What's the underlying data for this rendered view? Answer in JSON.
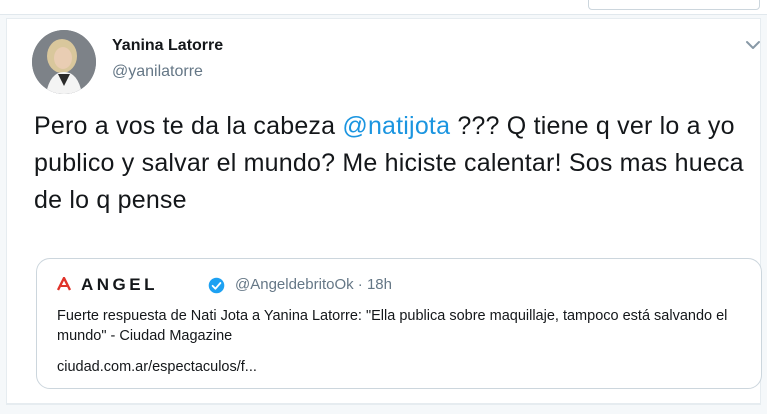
{
  "colors": {
    "accent": "#1b95e0",
    "verified": "#1da1f2",
    "text": "#14171a",
    "muted": "#657786",
    "brand_red": "#e0332a"
  },
  "tweet": {
    "author_name": "Yanina Latorre",
    "author_handle": "@yanilatorre",
    "avatar_icon": "profile-photo",
    "menu_icon": "chevron-down-icon",
    "text_before_mention": "Pero a vos te da la cabeza ",
    "mention": "@natijota",
    "text_after_mention": " ??? Q tiene q ver lo a yo publico y salvar el mundo? Me hiciste calentar! Sos mas hueca de lo q pense"
  },
  "quoted_tweet": {
    "logo_letter": "A",
    "brand_name": "ANGEL",
    "verified_icon": "verified-badge-icon",
    "handle_time": "@AngeldebritoOk · 18h",
    "body": "Fuerte respuesta de Nati Jota a Yanina Latorre: \"Ella publica sobre maquillaje, tampoco está salvando el mundo\" - Ciudad Magazine",
    "link": "ciudad.com.ar/espectaculos/f..."
  }
}
